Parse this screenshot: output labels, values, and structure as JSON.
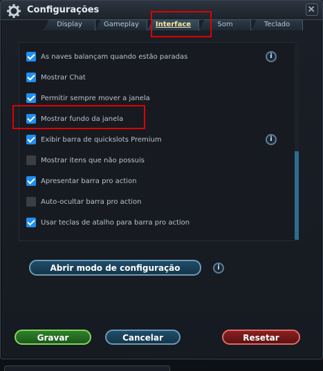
{
  "window": {
    "title": "Configurações",
    "close_label": ""
  },
  "tabs": [
    {
      "label": "Display"
    },
    {
      "label": "Gameplay"
    },
    {
      "label": "Interface"
    },
    {
      "label": "Som"
    },
    {
      "label": "Teclado"
    }
  ],
  "active_tab": "Interface",
  "options": [
    {
      "label": "As naves balançam quando estão paradas",
      "checked": true,
      "info": true
    },
    {
      "label": "Mostrar Chat",
      "checked": true,
      "info": false
    },
    {
      "label": "Permitir sempre mover a janela",
      "checked": true,
      "info": false
    },
    {
      "label": "Mostrar fundo da janela",
      "checked": true,
      "info": false
    },
    {
      "label": "Exibir barra de quickslots Premium",
      "checked": true,
      "info": true
    },
    {
      "label": "Mostrar itens que não possuis",
      "checked": false,
      "info": false
    },
    {
      "label": "Apresentar barra pro action",
      "checked": true,
      "info": false
    },
    {
      "label": "Auto-ocultar barra pro action",
      "checked": false,
      "info": false
    },
    {
      "label": "Usar teclas de atalho para barra pro action",
      "checked": true,
      "info": false
    }
  ],
  "buttons": {
    "config_mode": "Abrir modo de configuração",
    "save": "Gravar",
    "cancel": "Cancelar",
    "reset": "Resetar"
  },
  "info_glyph": "i",
  "colors": {
    "checkbox_on": "#1f8ff0",
    "highlight": "#e00000",
    "save_border": "#85d65b",
    "reset_border": "#e06c6c"
  }
}
